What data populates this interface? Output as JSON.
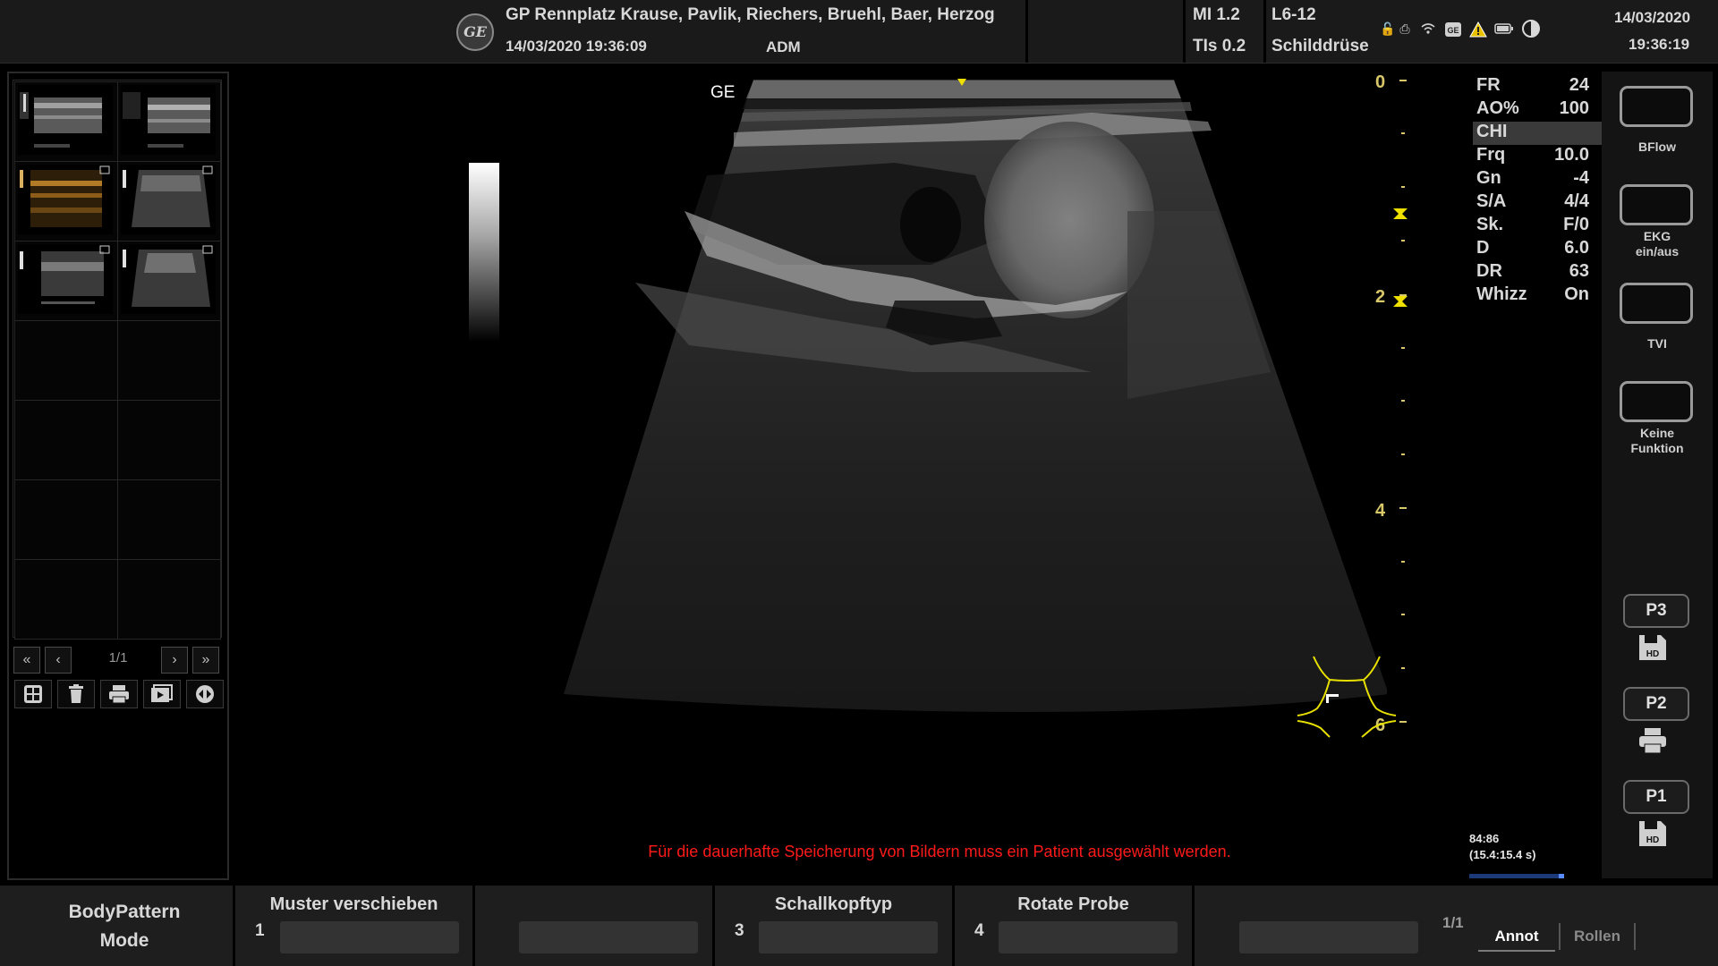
{
  "header": {
    "logo_text": "GE",
    "institution": "GP Rennplatz Krause, Pavlik, Riechers, Bruehl, Baer, Herzog",
    "exam_datetime": "14/03/2020 19:36:09",
    "operator": "ADM",
    "mi": "MI 1.2",
    "tis": "TIs 0.2",
    "probe": "L6-12",
    "preset": "Schilddrüse",
    "date": "14/03/2020",
    "time": "19:36:19",
    "status_icons": [
      "lock-icon",
      "network-icon",
      "wifi-icon",
      "ge-service-icon",
      "warning-icon",
      "battery-icon",
      "contrast-icon"
    ]
  },
  "thumbnails": {
    "page_indicator": "1/1",
    "pager": {
      "first": "«",
      "prev": "‹",
      "next": "›",
      "last": "»"
    },
    "tools": [
      "grid-icon",
      "trash-icon",
      "printer-icon",
      "video-icon",
      "transfer-icon"
    ]
  },
  "image": {
    "vendor_mark": "GE",
    "depth_labels": [
      "0",
      "2",
      "4",
      "6"
    ],
    "warning": "Für die dauerhafte Speicherung von Bildern muss ein Patient ausgewählt werden."
  },
  "params": [
    {
      "key": "FR",
      "value": "24"
    },
    {
      "key": "AO%",
      "value": "100"
    },
    {
      "key": "CHI",
      "value": "",
      "highlight": true
    },
    {
      "key": "Frq",
      "value": "10.0"
    },
    {
      "key": "Gn",
      "value": "-4"
    },
    {
      "key": "S/A",
      "value": "4/4"
    },
    {
      "key": "Sk.",
      "value": "F/0"
    },
    {
      "key": "D",
      "value": "6.0"
    },
    {
      "key": "DR",
      "value": "63"
    },
    {
      "key": "Whizz",
      "value": "On"
    }
  ],
  "loop": {
    "frames": "84:86",
    "duration": "(15.4:15.4 s)",
    "position_fraction": 0.98
  },
  "softkeys": {
    "bflow": "BFlow",
    "ekg_1": "EKG",
    "ekg_2": "ein/aus",
    "tvi": "TVI",
    "none_1": "Keine",
    "none_2": "Funktion",
    "p3": "P3",
    "p2": "P2",
    "p1": "P1",
    "hd": "HD"
  },
  "bottom": {
    "mode_1": "BodyPattern",
    "mode_2": "Mode",
    "slot1_num": "1",
    "slot1_title": "Muster verschieben",
    "slot3_num": "3",
    "slot3_title": "Schallkopftyp",
    "slot4_num": "4",
    "slot4_title": "Rotate Probe",
    "page": "1/1",
    "annot": "Annot",
    "rollen": "Rollen"
  },
  "colors": {
    "warning_text": "#ff1a1a",
    "depth_scale": "#d8c86a",
    "body_pattern": "#e8e000",
    "loop_bar": "#1c3a78"
  }
}
